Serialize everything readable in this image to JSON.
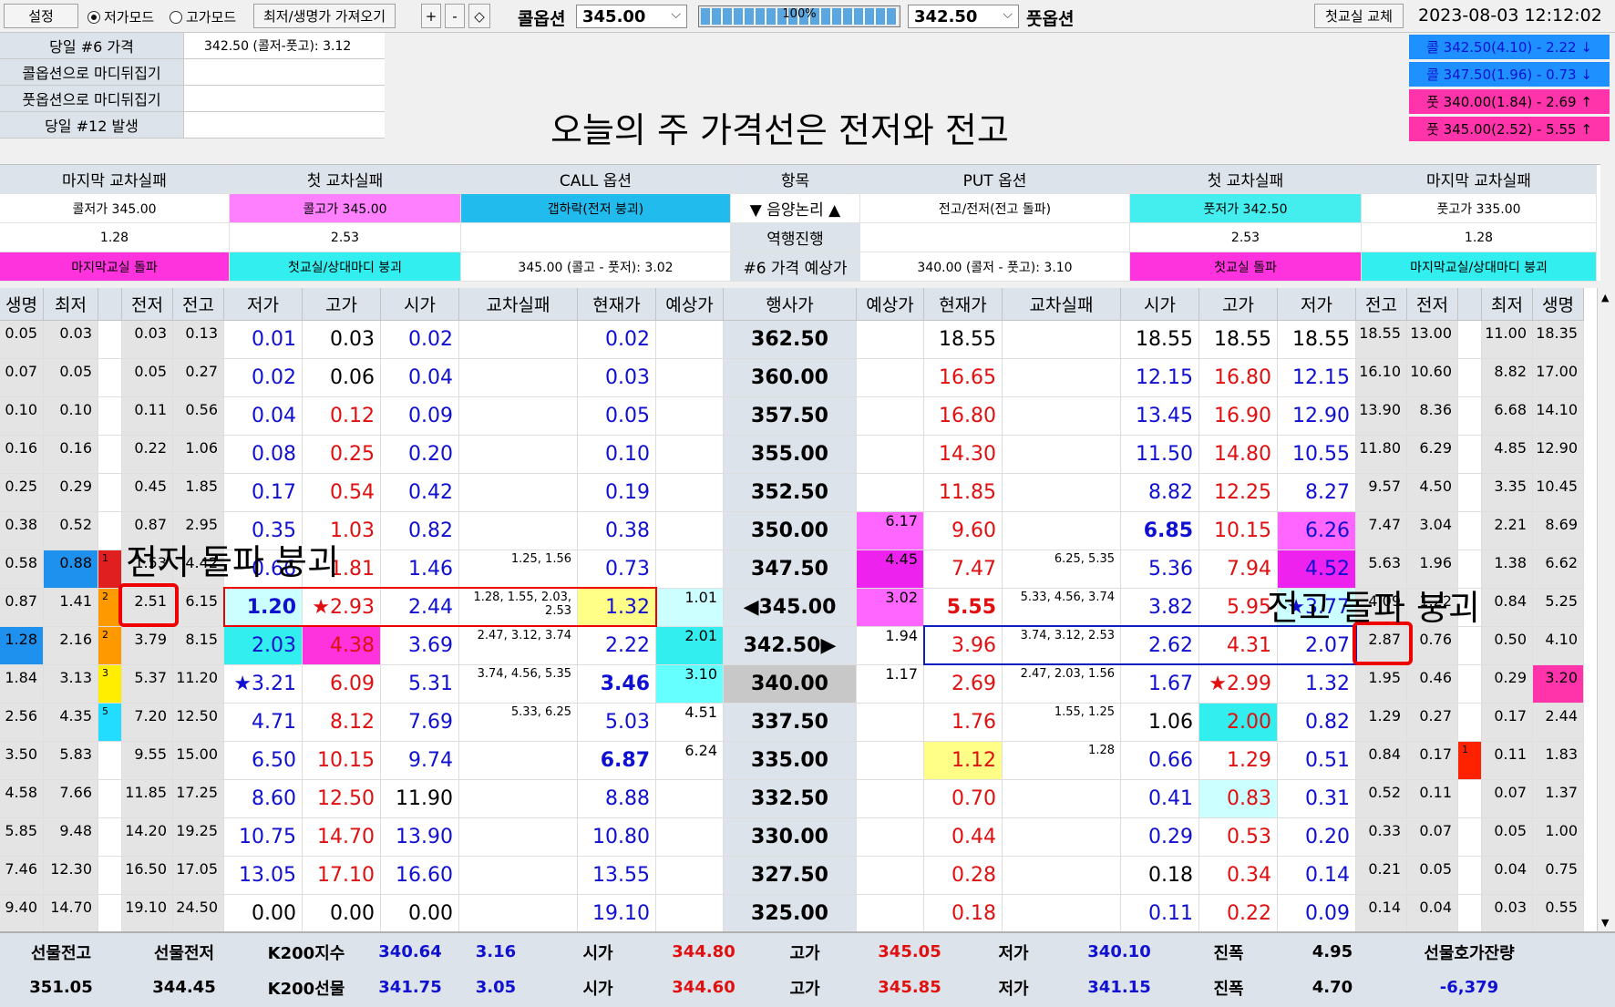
{
  "toolbar": {
    "settings": "설정",
    "mode_low": "저가모드",
    "mode_high": "고가모드",
    "fetch": "최저/생명가 가져오기",
    "plus": "+",
    "minus": "-",
    "diamond": "◇",
    "call_label": "콜옵션",
    "call_value": "345.00",
    "progress": "100%",
    "put_value": "342.50",
    "put_label": "풋옵션",
    "swap": "첫교실 교체",
    "datetime": "2023-08-03 12:12:02"
  },
  "info": [
    {
      "label": "당일 #6 가격",
      "value": "342.50 (콜저-풋고): 3.12"
    },
    {
      "label": "콜옵션으로 마디뒤집기",
      "value": ""
    },
    {
      "label": "풋옵션으로 마디뒤집기",
      "value": ""
    },
    {
      "label": "당일 #12 발생",
      "value": ""
    }
  ],
  "headline": "오늘의 주 가격선은 전저와 전고",
  "alerts": [
    {
      "text": "콜 342.50(4.10) - 2.22 ↓",
      "color": "blue"
    },
    {
      "text": "콜 347.50(1.96) - 0.73 ↓",
      "color": "blue"
    },
    {
      "text": "풋 340.00(1.84) - 2.69 ↑",
      "color": "pink"
    },
    {
      "text": "풋 345.00(2.52) - 5.55 ↑",
      "color": "pink"
    }
  ],
  "summary": [
    {
      "head": "마지막 교차실패",
      "r1": "콜저가 345.00",
      "r2": "1.28",
      "r3": "마지막교실 돌파"
    },
    {
      "head": "첫 교차실패",
      "r1": "콜고가 345.00",
      "r2": "2.53",
      "r3": "첫교실/상대마디 붕괴"
    },
    {
      "head": "CALL 옵션",
      "r1": "갭하락(전저 붕괴)",
      "r2": "",
      "r3": "345.00 (콜고 - 풋저): 3.02"
    },
    {
      "head": "항목",
      "r1": "▼ 음양논리 ▲",
      "r2": "역행진행",
      "r3": "#6 가격 예상가"
    },
    {
      "head": "PUT 옵션",
      "r1": "전고/전저(전고 돌파)",
      "r2": "",
      "r3": "340.00 (콜저 - 풋고): 3.10"
    },
    {
      "head": "첫 교차실패",
      "r1": "풋저가 342.50",
      "r2": "2.53",
      "r3": "첫교실 돌파"
    },
    {
      "head": "마지막 교차실패",
      "r1": "풋고가 335.00",
      "r2": "1.28",
      "r3": "마지막교실/상대마디 붕괴"
    }
  ],
  "headers": [
    "생명",
    "최저",
    "",
    "전저",
    "전고",
    "저가",
    "고가",
    "시가",
    "교차실패",
    "현재가",
    "예상가",
    "행사가",
    "예상가",
    "현재가",
    "교차실패",
    "시가",
    "고가",
    "저가",
    "전고",
    "전저",
    "",
    "최저",
    "생명"
  ],
  "rows": [
    [
      "0.05",
      "0.03",
      "",
      "0.03",
      "0.13",
      "0.01",
      "0.03",
      "0.02",
      "",
      "0.02",
      "",
      "362.50",
      "",
      "18.55",
      "",
      "18.55",
      "18.55",
      "18.55",
      "18.55",
      "13.00",
      "",
      "11.00",
      "18.35"
    ],
    [
      "0.07",
      "0.05",
      "",
      "0.05",
      "0.27",
      "0.02",
      "0.06",
      "0.04",
      "",
      "0.03",
      "",
      "360.00",
      "",
      "16.65",
      "",
      "12.15",
      "16.80",
      "12.15",
      "16.10",
      "10.60",
      "",
      "8.82",
      "17.00"
    ],
    [
      "0.10",
      "0.10",
      "",
      "0.11",
      "0.56",
      "0.04",
      "0.12",
      "0.09",
      "",
      "0.05",
      "",
      "357.50",
      "",
      "16.80",
      "",
      "13.45",
      "16.90",
      "12.90",
      "13.90",
      "8.36",
      "",
      "6.68",
      "14.10"
    ],
    [
      "0.16",
      "0.16",
      "",
      "0.22",
      "1.06",
      "0.08",
      "0.25",
      "0.20",
      "",
      "0.10",
      "",
      "355.00",
      "",
      "14.30",
      "",
      "11.50",
      "14.80",
      "10.55",
      "11.80",
      "6.29",
      "",
      "4.85",
      "12.90"
    ],
    [
      "0.25",
      "0.29",
      "",
      "0.45",
      "1.85",
      "0.17",
      "0.54",
      "0.42",
      "",
      "0.19",
      "",
      "352.50",
      "",
      "11.85",
      "",
      "8.82",
      "12.25",
      "8.27",
      "9.57",
      "4.50",
      "",
      "3.35",
      "10.45"
    ],
    [
      "0.38",
      "0.52",
      "",
      "0.87",
      "2.95",
      "0.35",
      "1.03",
      "0.82",
      "",
      "0.38",
      "",
      "350.00",
      "6.17",
      "9.60",
      "",
      "6.85",
      "10.15",
      "6.26",
      "7.47",
      "3.04",
      "",
      "2.21",
      "8.69"
    ],
    [
      "0.58",
      "0.88",
      "1",
      "1.53",
      "4.42",
      "0.66",
      "1.81",
      "1.46",
      "1.25, 1.56",
      "0.73",
      "",
      "347.50",
      "4.45",
      "7.47",
      "6.25, 5.35",
      "5.36",
      "7.94",
      "4.52",
      "5.63",
      "1.96",
      "",
      "1.38",
      "6.62"
    ],
    [
      "0.87",
      "1.41",
      "2",
      "2.51",
      "6.15",
      "1.20",
      "★2.93",
      "2.44",
      "1.28, 1.55, 2.03, 2.53",
      "1.32",
      "1.01",
      "◀345.00",
      "3.02",
      "5.55",
      "5.33, 4.56, 3.74",
      "3.82",
      "5.95",
      "★3.77",
      "4.09",
      "1.22",
      "",
      "0.84",
      "5.25"
    ],
    [
      "1.28",
      "2.16",
      "2",
      "3.79",
      "8.15",
      "2.03",
      "4.38",
      "3.69",
      "2.47, 3.12, 3.74",
      "2.22",
      "2.01",
      "342.50▶",
      "1.94",
      "3.96",
      "3.74, 3.12, 2.53",
      "2.62",
      "4.31",
      "2.07",
      "2.87",
      "0.76",
      "",
      "0.50",
      "4.10"
    ],
    [
      "1.84",
      "3.13",
      "3",
      "5.37",
      "11.20",
      "★3.21",
      "6.09",
      "5.31",
      "3.74, 4.56, 5.35",
      "3.46",
      "3.10",
      "340.00",
      "1.17",
      "2.69",
      "2.47, 2.03, 1.56",
      "1.67",
      "★2.99",
      "1.32",
      "1.95",
      "0.46",
      "",
      "0.29",
      "3.20"
    ],
    [
      "2.56",
      "4.35",
      "5",
      "7.20",
      "12.50",
      "4.71",
      "8.12",
      "7.69",
      "5.33, 6.25",
      "5.03",
      "4.51",
      "337.50",
      "",
      "1.76",
      "1.55, 1.25",
      "1.06",
      "2.00",
      "0.82",
      "1.29",
      "0.27",
      "",
      "0.17",
      "2.44"
    ],
    [
      "3.50",
      "5.83",
      "",
      "9.55",
      "15.00",
      "6.50",
      "10.15",
      "9.74",
      "",
      "6.87",
      "6.24",
      "335.00",
      "",
      "1.12",
      "1.28",
      "0.66",
      "1.29",
      "0.51",
      "0.84",
      "0.17",
      "1",
      "0.11",
      "1.83"
    ],
    [
      "4.58",
      "7.66",
      "",
      "11.85",
      "17.25",
      "8.60",
      "12.50",
      "11.90",
      "",
      "8.88",
      "",
      "332.50",
      "",
      "0.70",
      "",
      "0.41",
      "0.83",
      "0.31",
      "0.52",
      "0.11",
      "",
      "0.07",
      "1.37"
    ],
    [
      "5.85",
      "9.48",
      "",
      "14.20",
      "19.25",
      "10.75",
      "14.70",
      "13.90",
      "",
      "10.80",
      "",
      "330.00",
      "",
      "0.44",
      "",
      "0.29",
      "0.53",
      "0.20",
      "0.33",
      "0.07",
      "",
      "0.05",
      "1.00"
    ],
    [
      "7.46",
      "12.30",
      "",
      "16.50",
      "17.05",
      "13.05",
      "17.10",
      "16.60",
      "",
      "13.55",
      "",
      "327.50",
      "",
      "0.28",
      "",
      "0.18",
      "0.34",
      "0.14",
      "0.21",
      "0.05",
      "",
      "0.04",
      "0.75"
    ],
    [
      "9.40",
      "14.70",
      "",
      "19.10",
      "24.50",
      "0.00",
      "0.00",
      "0.00",
      "",
      "19.10",
      "",
      "325.00",
      "",
      "0.18",
      "",
      "0.11",
      "0.22",
      "0.09",
      "0.14",
      "0.04",
      "",
      "0.03",
      "0.55"
    ]
  ],
  "footer": {
    "r1": [
      "선물전고",
      "선물전저",
      "K200지수",
      "340.64",
      "3.16",
      "시가",
      "344.80",
      "고가",
      "345.05",
      "저가",
      "340.10",
      "진폭",
      "4.95",
      "선물호가잔량"
    ],
    "r2": [
      "351.05",
      "344.45",
      "K200선물",
      "341.75",
      "3.05",
      "시가",
      "344.60",
      "고가",
      "345.85",
      "저가",
      "341.15",
      "진폭",
      "4.70",
      "-6,379"
    ]
  },
  "annotations": {
    "left": "전저 돌파 붕괴",
    "right": "전고 돌파 붕괴"
  }
}
